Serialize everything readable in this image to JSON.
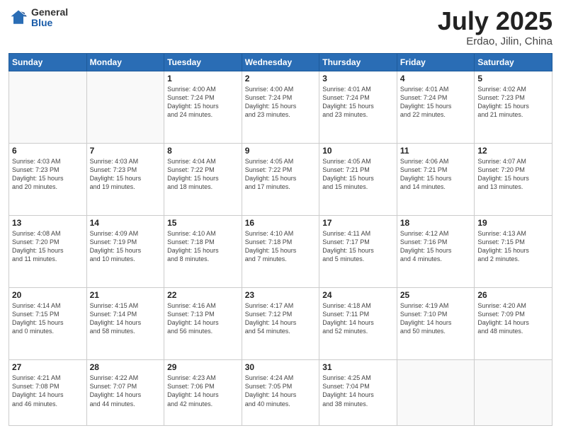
{
  "logo": {
    "general": "General",
    "blue": "Blue"
  },
  "title": {
    "month_year": "July 2025",
    "location": "Erdao, Jilin, China"
  },
  "weekdays": [
    "Sunday",
    "Monday",
    "Tuesday",
    "Wednesday",
    "Thursday",
    "Friday",
    "Saturday"
  ],
  "weeks": [
    [
      {
        "day": "",
        "info": ""
      },
      {
        "day": "",
        "info": ""
      },
      {
        "day": "1",
        "info": "Sunrise: 4:00 AM\nSunset: 7:24 PM\nDaylight: 15 hours\nand 24 minutes."
      },
      {
        "day": "2",
        "info": "Sunrise: 4:00 AM\nSunset: 7:24 PM\nDaylight: 15 hours\nand 23 minutes."
      },
      {
        "day": "3",
        "info": "Sunrise: 4:01 AM\nSunset: 7:24 PM\nDaylight: 15 hours\nand 23 minutes."
      },
      {
        "day": "4",
        "info": "Sunrise: 4:01 AM\nSunset: 7:24 PM\nDaylight: 15 hours\nand 22 minutes."
      },
      {
        "day": "5",
        "info": "Sunrise: 4:02 AM\nSunset: 7:23 PM\nDaylight: 15 hours\nand 21 minutes."
      }
    ],
    [
      {
        "day": "6",
        "info": "Sunrise: 4:03 AM\nSunset: 7:23 PM\nDaylight: 15 hours\nand 20 minutes."
      },
      {
        "day": "7",
        "info": "Sunrise: 4:03 AM\nSunset: 7:23 PM\nDaylight: 15 hours\nand 19 minutes."
      },
      {
        "day": "8",
        "info": "Sunrise: 4:04 AM\nSunset: 7:22 PM\nDaylight: 15 hours\nand 18 minutes."
      },
      {
        "day": "9",
        "info": "Sunrise: 4:05 AM\nSunset: 7:22 PM\nDaylight: 15 hours\nand 17 minutes."
      },
      {
        "day": "10",
        "info": "Sunrise: 4:05 AM\nSunset: 7:21 PM\nDaylight: 15 hours\nand 15 minutes."
      },
      {
        "day": "11",
        "info": "Sunrise: 4:06 AM\nSunset: 7:21 PM\nDaylight: 15 hours\nand 14 minutes."
      },
      {
        "day": "12",
        "info": "Sunrise: 4:07 AM\nSunset: 7:20 PM\nDaylight: 15 hours\nand 13 minutes."
      }
    ],
    [
      {
        "day": "13",
        "info": "Sunrise: 4:08 AM\nSunset: 7:20 PM\nDaylight: 15 hours\nand 11 minutes."
      },
      {
        "day": "14",
        "info": "Sunrise: 4:09 AM\nSunset: 7:19 PM\nDaylight: 15 hours\nand 10 minutes."
      },
      {
        "day": "15",
        "info": "Sunrise: 4:10 AM\nSunset: 7:18 PM\nDaylight: 15 hours\nand 8 minutes."
      },
      {
        "day": "16",
        "info": "Sunrise: 4:10 AM\nSunset: 7:18 PM\nDaylight: 15 hours\nand 7 minutes."
      },
      {
        "day": "17",
        "info": "Sunrise: 4:11 AM\nSunset: 7:17 PM\nDaylight: 15 hours\nand 5 minutes."
      },
      {
        "day": "18",
        "info": "Sunrise: 4:12 AM\nSunset: 7:16 PM\nDaylight: 15 hours\nand 4 minutes."
      },
      {
        "day": "19",
        "info": "Sunrise: 4:13 AM\nSunset: 7:15 PM\nDaylight: 15 hours\nand 2 minutes."
      }
    ],
    [
      {
        "day": "20",
        "info": "Sunrise: 4:14 AM\nSunset: 7:15 PM\nDaylight: 15 hours\nand 0 minutes."
      },
      {
        "day": "21",
        "info": "Sunrise: 4:15 AM\nSunset: 7:14 PM\nDaylight: 14 hours\nand 58 minutes."
      },
      {
        "day": "22",
        "info": "Sunrise: 4:16 AM\nSunset: 7:13 PM\nDaylight: 14 hours\nand 56 minutes."
      },
      {
        "day": "23",
        "info": "Sunrise: 4:17 AM\nSunset: 7:12 PM\nDaylight: 14 hours\nand 54 minutes."
      },
      {
        "day": "24",
        "info": "Sunrise: 4:18 AM\nSunset: 7:11 PM\nDaylight: 14 hours\nand 52 minutes."
      },
      {
        "day": "25",
        "info": "Sunrise: 4:19 AM\nSunset: 7:10 PM\nDaylight: 14 hours\nand 50 minutes."
      },
      {
        "day": "26",
        "info": "Sunrise: 4:20 AM\nSunset: 7:09 PM\nDaylight: 14 hours\nand 48 minutes."
      }
    ],
    [
      {
        "day": "27",
        "info": "Sunrise: 4:21 AM\nSunset: 7:08 PM\nDaylight: 14 hours\nand 46 minutes."
      },
      {
        "day": "28",
        "info": "Sunrise: 4:22 AM\nSunset: 7:07 PM\nDaylight: 14 hours\nand 44 minutes."
      },
      {
        "day": "29",
        "info": "Sunrise: 4:23 AM\nSunset: 7:06 PM\nDaylight: 14 hours\nand 42 minutes."
      },
      {
        "day": "30",
        "info": "Sunrise: 4:24 AM\nSunset: 7:05 PM\nDaylight: 14 hours\nand 40 minutes."
      },
      {
        "day": "31",
        "info": "Sunrise: 4:25 AM\nSunset: 7:04 PM\nDaylight: 14 hours\nand 38 minutes."
      },
      {
        "day": "",
        "info": ""
      },
      {
        "day": "",
        "info": ""
      }
    ]
  ]
}
